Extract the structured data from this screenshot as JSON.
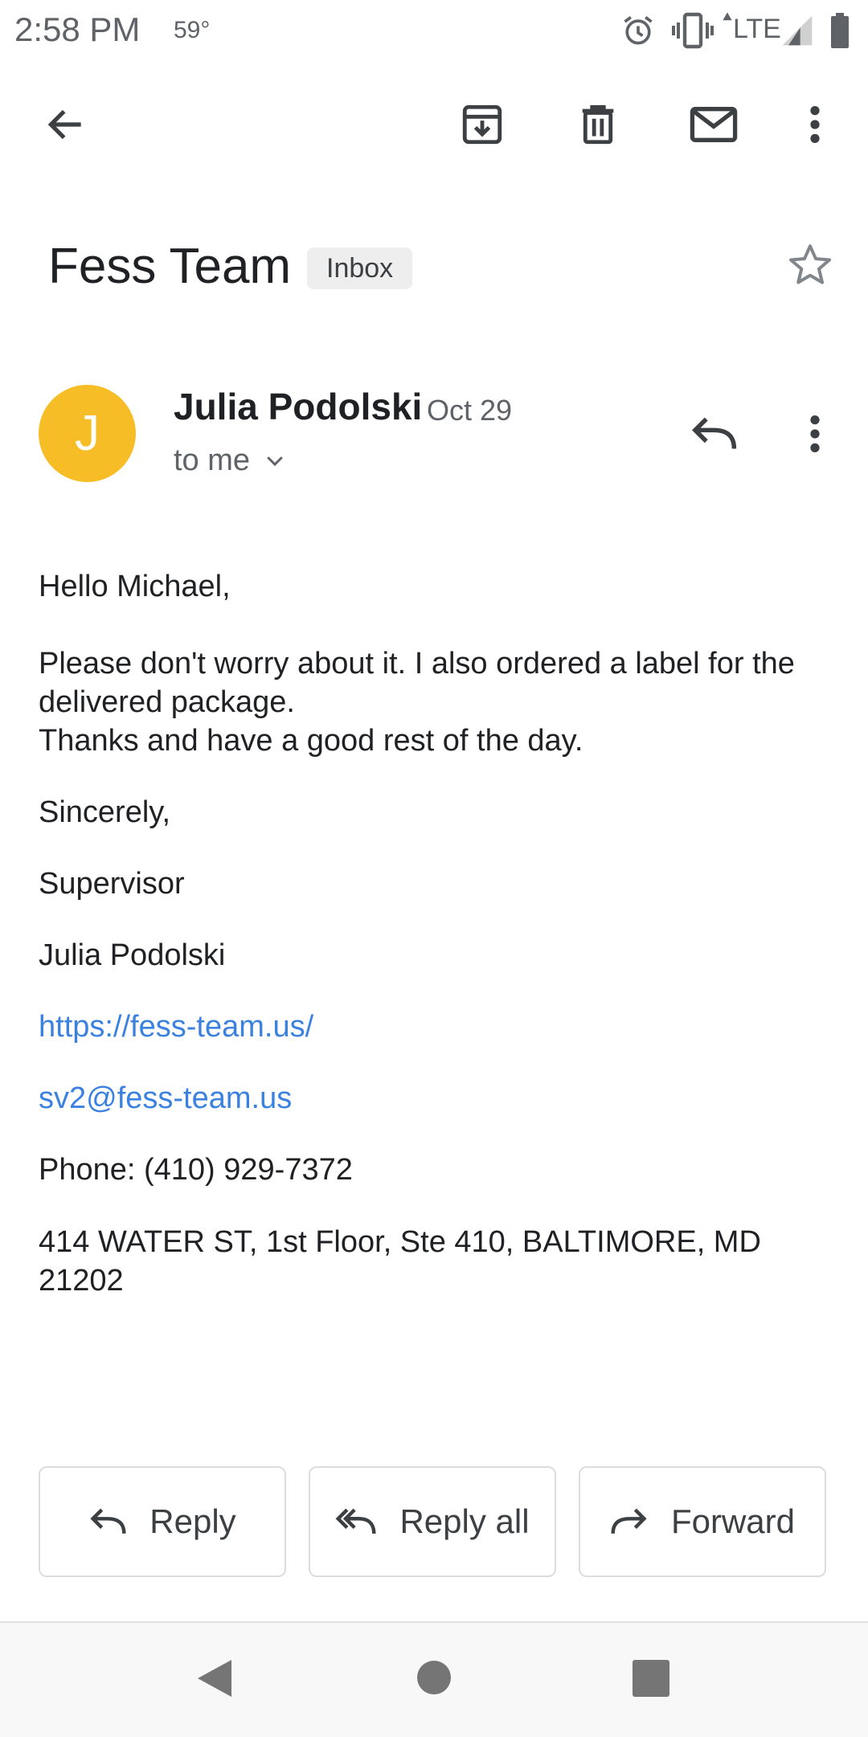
{
  "status_bar": {
    "time": "2:58 PM",
    "temperature": "59°",
    "network": "LTE",
    "icons": [
      "alarm-icon",
      "vibrate-icon",
      "signal-icon",
      "battery-icon"
    ]
  },
  "toolbar": {
    "icons": [
      "back-arrow-icon",
      "archive-icon",
      "delete-icon",
      "mark-unread-icon",
      "more-vert-icon"
    ]
  },
  "email": {
    "subject": "Fess Team",
    "label": "Inbox",
    "sender": {
      "initial": "J",
      "name": "Julia Podolski",
      "date": "Oct 29",
      "recipient": "to me",
      "avatar_color": "#f7bd26"
    },
    "body": {
      "greeting": "Hello Michael,",
      "paragraph_line1": "Please don't worry about it. I also ordered a label for the delivered package.",
      "paragraph_line2": "Thanks and have a good rest of the day.",
      "closing": "Sincerely,",
      "title": "Supervisor",
      "signature_name": "Julia Podolski",
      "website": "https://fess-team.us/",
      "email": "sv2@fess-team.us",
      "phone": "Phone: (410) 929-7372",
      "address": "414 WATER ST, 1st Floor, Ste 410, BALTIMORE, MD 21202"
    }
  },
  "actions": {
    "reply": "Reply",
    "reply_all": "Reply all",
    "forward": "Forward"
  },
  "colors": {
    "link": "#3b82e0",
    "text": "#202124",
    "muted": "#5f6368"
  }
}
